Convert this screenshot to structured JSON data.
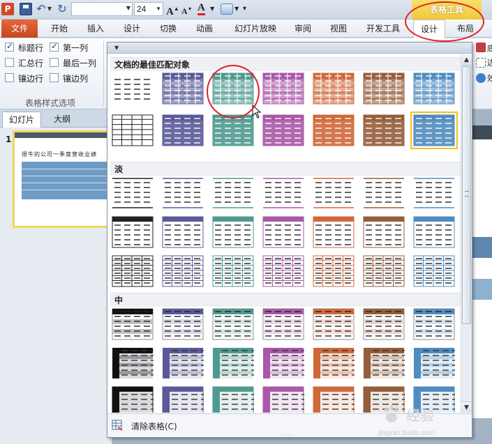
{
  "quick_access": {
    "font_size": "24",
    "grow_font": "A",
    "shrink_font": "A",
    "font_color": "A"
  },
  "contextual_group": "表格工具",
  "tabs": [
    "文件",
    "开始",
    "插入",
    "设计",
    "切换",
    "动画",
    "幻灯片放映",
    "审阅",
    "视图",
    "开发工具",
    "设计",
    "布局"
  ],
  "ribbon": {
    "options": [
      {
        "label": "标题行",
        "checked": true
      },
      {
        "label": "第一列",
        "checked": true
      },
      {
        "label": "汇总行",
        "checked": false
      },
      {
        "label": "最后一列",
        "checked": false
      },
      {
        "label": "镶边行",
        "checked": false
      },
      {
        "label": "镶边列",
        "checked": false
      }
    ],
    "group_label": "表格样式选项",
    "right_labels": [
      "底",
      "边",
      "效"
    ]
  },
  "left_panel": {
    "tabs": [
      "幻灯片",
      "大纲"
    ],
    "slide_number": "1",
    "thumb_title": "很牛的公司一季度营收业绩"
  },
  "gallery": {
    "sections": [
      "文档的最佳匹配对象",
      "淡",
      "中"
    ],
    "footer_label": "清除表格(C)"
  },
  "colors": [
    "#4a4a4a",
    "#5a5a9a",
    "#4f9a90",
    "#a957a8",
    "#d0693a",
    "#955e3a",
    "#4f8cc0"
  ],
  "watermark": {
    "text": "经验",
    "url": "jingyan.baidu.com"
  }
}
